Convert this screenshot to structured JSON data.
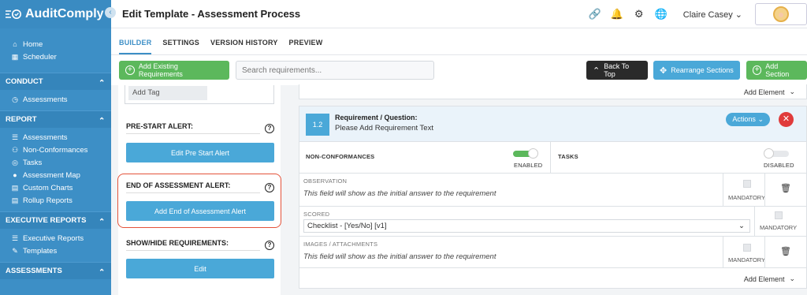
{
  "brand": {
    "name": "AuditComply"
  },
  "sidebar": {
    "top_items": [
      {
        "label": "Home",
        "icon": "home-icon"
      },
      {
        "label": "Scheduler",
        "icon": "calendar-icon"
      }
    ],
    "sections": [
      {
        "title": "CONDUCT",
        "items": [
          {
            "label": "Assessments",
            "icon": "clock-icon"
          }
        ]
      },
      {
        "title": "REPORT",
        "items": [
          {
            "label": "Assessments",
            "icon": "list-icon"
          },
          {
            "label": "Non-Conformances",
            "icon": "users-icon"
          },
          {
            "label": "Tasks",
            "icon": "target-icon"
          },
          {
            "label": "Assessment Map",
            "icon": "map-pin-icon"
          },
          {
            "label": "Custom Charts",
            "icon": "chart-icon"
          },
          {
            "label": "Rollup Reports",
            "icon": "chart-icon"
          }
        ]
      },
      {
        "title": "EXECUTIVE REPORTS",
        "items": [
          {
            "label": "Executive Reports",
            "icon": "list-icon"
          },
          {
            "label": "Templates",
            "icon": "edit-icon"
          }
        ]
      },
      {
        "title": "ASSESSMENTS",
        "items": []
      }
    ]
  },
  "header": {
    "title": "Edit Template - Assessment Process",
    "user_name": "Claire Casey"
  },
  "tabs": [
    "BUILDER",
    "SETTINGS",
    "VERSION HISTORY",
    "PREVIEW"
  ],
  "toolbar": {
    "add_existing": "Add Existing Requirements",
    "search_placeholder": "Search requirements...",
    "back_to_top": "Back To Top",
    "rearrange": "Rearrange Sections",
    "add_section": "Add Section"
  },
  "left_panel": {
    "add_tag": "Add Tag",
    "pre_start_label": "PRE-START ALERT:",
    "pre_start_button": "Edit Pre Start Alert",
    "end_label": "END OF ASSESSMENT ALERT:",
    "end_button": "Add End of Assessment Alert",
    "show_hide_label": "SHOW/HIDE REQUIREMENTS:",
    "edit_button": "Edit"
  },
  "requirement": {
    "add_element": "Add Element",
    "number": "1.2",
    "title": "Requirement / Question:",
    "text": "Please Add Requirement Text",
    "actions": "Actions",
    "nc_label": "NON-CONFORMANCES",
    "nc_state": "ENABLED",
    "tasks_label": "TASKS",
    "tasks_state": "DISABLED",
    "observation_label": "OBSERVATION",
    "observation_hint": "This field will show as the initial answer to the requirement",
    "mandatory": "MANDATORY",
    "scored_label": "SCORED",
    "scored_value": "Checklist - [Yes/No] [v1]",
    "images_label": "IMAGES / ATTACHMENTS",
    "images_hint": "This field will show as the initial answer to the requirement",
    "add_element_bottom": "Add Element"
  },
  "colors": {
    "sidebar": "#3d8fc6",
    "accent_blue": "#4aa8d8",
    "green": "#5cb85c",
    "dark": "#2a2a2a",
    "danger": "#e03b3b",
    "highlight": "#e4533a"
  }
}
